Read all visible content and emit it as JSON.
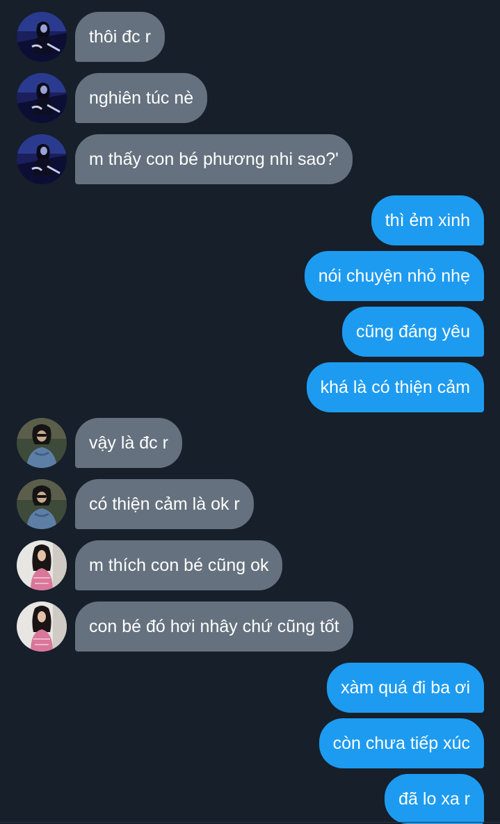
{
  "chat": {
    "messages": [
      {
        "text": "thôi đc r",
        "direction": "incoming",
        "avatar": "avatar-a"
      },
      {
        "text": "nghiên túc nè",
        "direction": "incoming",
        "avatar": "avatar-a"
      },
      {
        "text": "m thấy con bé phương nhi sao?'",
        "direction": "incoming",
        "avatar": "avatar-a"
      },
      {
        "text": "thì ẻm xinh",
        "direction": "outgoing"
      },
      {
        "text": "nói chuyện nhỏ nhẹ",
        "direction": "outgoing"
      },
      {
        "text": "cũng đáng yêu",
        "direction": "outgoing"
      },
      {
        "text": "khá là có thiện cảm",
        "direction": "outgoing"
      },
      {
        "text": "vậy là đc r",
        "direction": "incoming",
        "avatar": "avatar-b"
      },
      {
        "text": "có thiện cảm là ok r",
        "direction": "incoming",
        "avatar": "avatar-b"
      },
      {
        "text": "m thích con bé cũng ok",
        "direction": "incoming",
        "avatar": "avatar-c"
      },
      {
        "text": "con bé đó hơi nhây chứ cũng tốt",
        "direction": "incoming",
        "avatar": "avatar-c"
      },
      {
        "text": "xàm quá đi ba ơi",
        "direction": "outgoing"
      },
      {
        "text": "còn chưa tiếp xúc",
        "direction": "outgoing"
      },
      {
        "text": "đã lo xa r",
        "direction": "outgoing"
      }
    ]
  },
  "colors": {
    "background": "#161f2a",
    "incoming_bubble": "#65717e",
    "outgoing_bubble": "#1d9bf0",
    "text": "#ffffff"
  }
}
